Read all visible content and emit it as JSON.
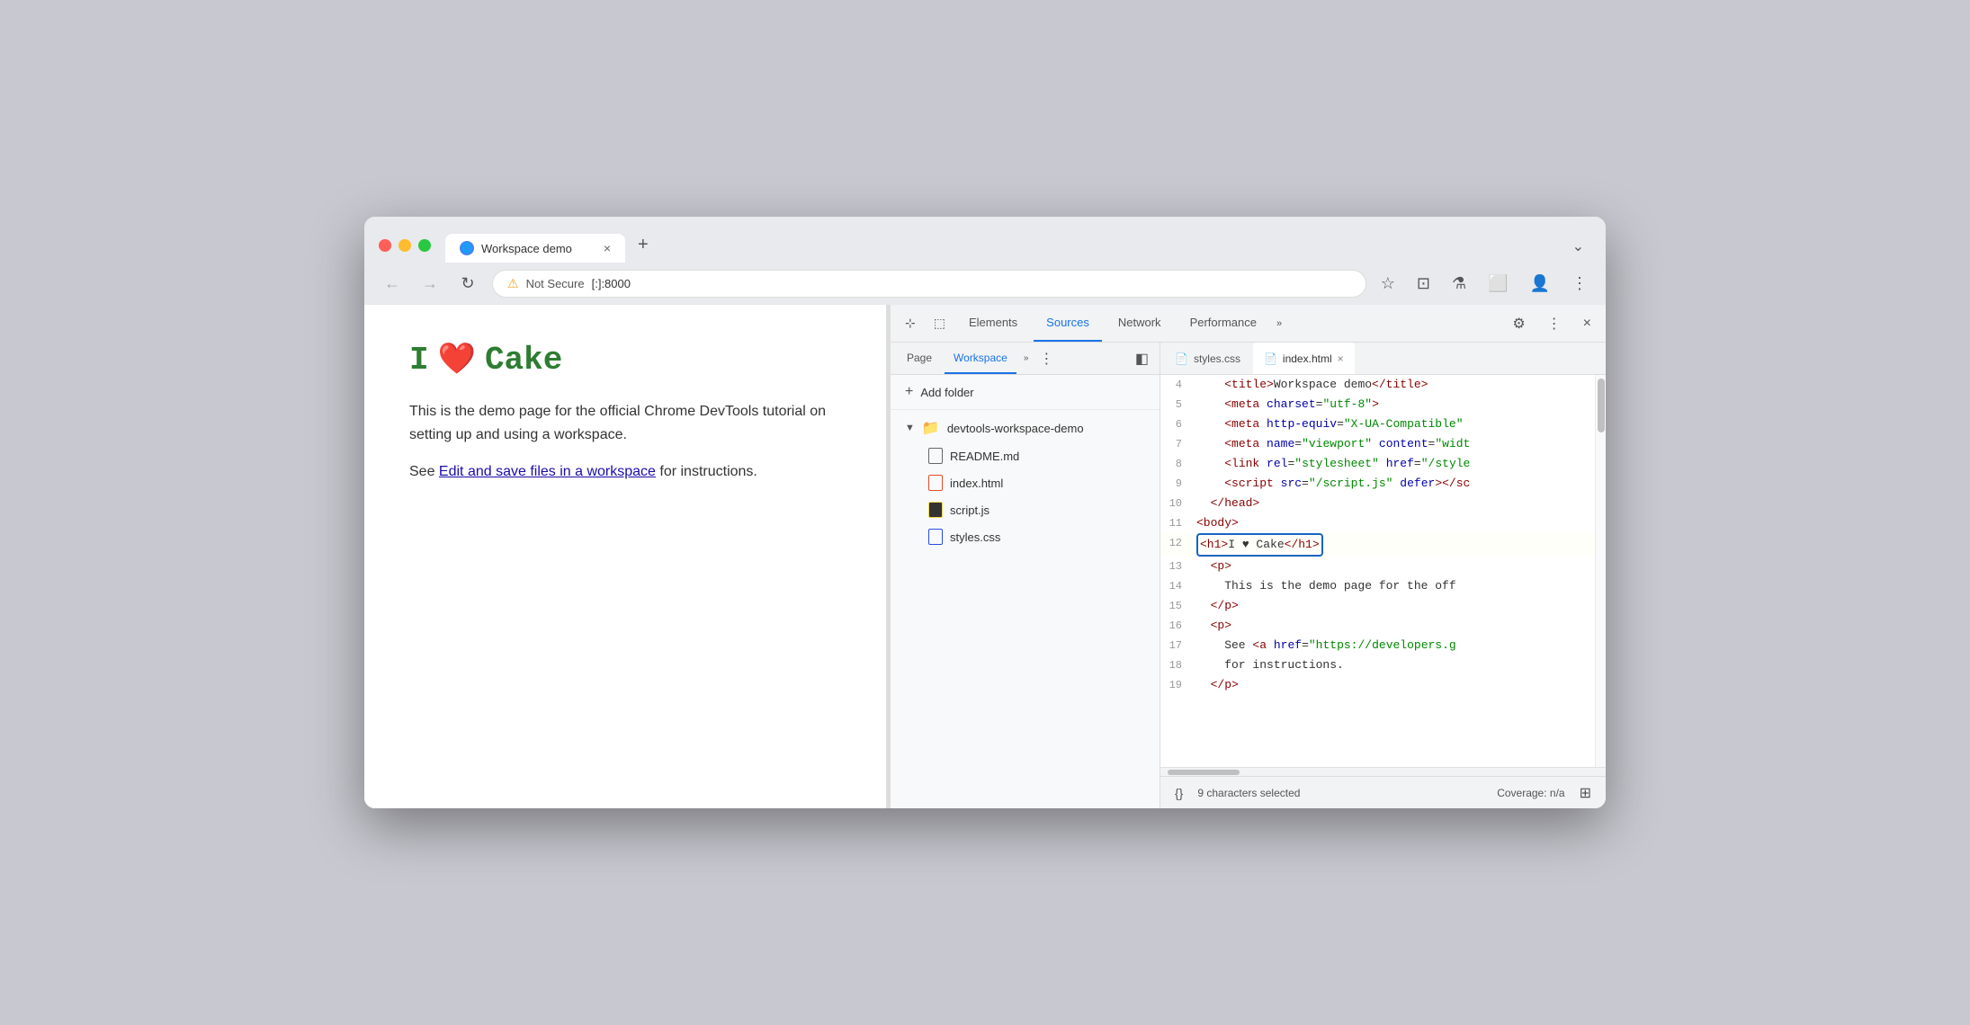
{
  "browser": {
    "tab_title": "Workspace demo",
    "tab_icon": "🌐",
    "tab_close": "×",
    "new_tab": "+",
    "chevron": "⌄",
    "nav_back": "←",
    "nav_forward": "→",
    "nav_refresh": "↻",
    "address_warning": "⚠",
    "address_not_secure": "Not Secure",
    "address_url": "[:]:8000",
    "addr_star": "☆",
    "addr_ext": "⊡",
    "addr_lab": "⚗",
    "addr_sidebar": "⬜",
    "addr_profile": "👤",
    "addr_menu": "⋮"
  },
  "devtools": {
    "tab_cursor": "⊹",
    "tab_inspect": "⬚",
    "tabs": [
      {
        "label": "Elements",
        "active": false
      },
      {
        "label": "Sources",
        "active": true
      },
      {
        "label": "Network",
        "active": false
      },
      {
        "label": "Performance",
        "active": false
      }
    ],
    "tab_more": "»",
    "toolbar_settings": "⚙",
    "toolbar_more": "⋮",
    "toolbar_close": "×"
  },
  "sources": {
    "subtabs": [
      {
        "label": "Page",
        "active": false
      },
      {
        "label": "Workspace",
        "active": true
      }
    ],
    "subtab_more": "»",
    "subtab_more2": "⋮",
    "subtab_sidebar": "◧",
    "add_folder_label": "Add folder",
    "folder_name": "devtools-workspace-demo",
    "files": [
      {
        "name": "README.md",
        "type": "md"
      },
      {
        "name": "index.html",
        "type": "html"
      },
      {
        "name": "script.js",
        "type": "js"
      },
      {
        "name": "styles.css",
        "type": "css"
      }
    ]
  },
  "editor": {
    "tabs": [
      {
        "label": "styles.css",
        "type": "css",
        "active": false,
        "closeable": false
      },
      {
        "label": "index.html",
        "type": "html",
        "active": true,
        "closeable": true
      }
    ],
    "lines": [
      {
        "num": 4,
        "content": "    <title>Workspace demo</title>"
      },
      {
        "num": 5,
        "content": "    <meta charset=\"utf-8\">"
      },
      {
        "num": 6,
        "content": "    <meta http-equiv=\"X-UA-Compatible\""
      },
      {
        "num": 7,
        "content": "    <meta name=\"viewport\" content=\"widt"
      },
      {
        "num": 8,
        "content": "    <link rel=\"stylesheet\" href=\"/style"
      },
      {
        "num": 9,
        "content": "    <script src=\"/script.js\" defer></sc"
      },
      {
        "num": 10,
        "content": "  </head>"
      },
      {
        "num": 11,
        "content": "<body>"
      },
      {
        "num": 12,
        "content": "<h1>I ♥ Cake</h1>",
        "highlighted": true
      },
      {
        "num": 13,
        "content": "  <p>"
      },
      {
        "num": 14,
        "content": "    This is the demo page for the off"
      },
      {
        "num": 15,
        "content": "  </p>"
      },
      {
        "num": 16,
        "content": "  <p>"
      },
      {
        "num": 17,
        "content": "    See <a href=\"https://developers.g"
      },
      {
        "num": 18,
        "content": "    for instructions."
      },
      {
        "num": 19,
        "content": "  </p>"
      }
    ]
  },
  "page": {
    "heading_green": "I",
    "heading_heart": "❤",
    "heading_cake": "Cake",
    "body_text1": "This is the demo page for the official Chrome DevTools tutorial on setting up and using a workspace.",
    "body_text2_pre": "See ",
    "body_link": "Edit and save files in a workspace",
    "body_text2_post": " for instructions."
  },
  "status_bar": {
    "braces": "{}",
    "selected": "9 characters selected",
    "coverage": "Coverage: n/a",
    "screenshot_icon": "⊞"
  }
}
